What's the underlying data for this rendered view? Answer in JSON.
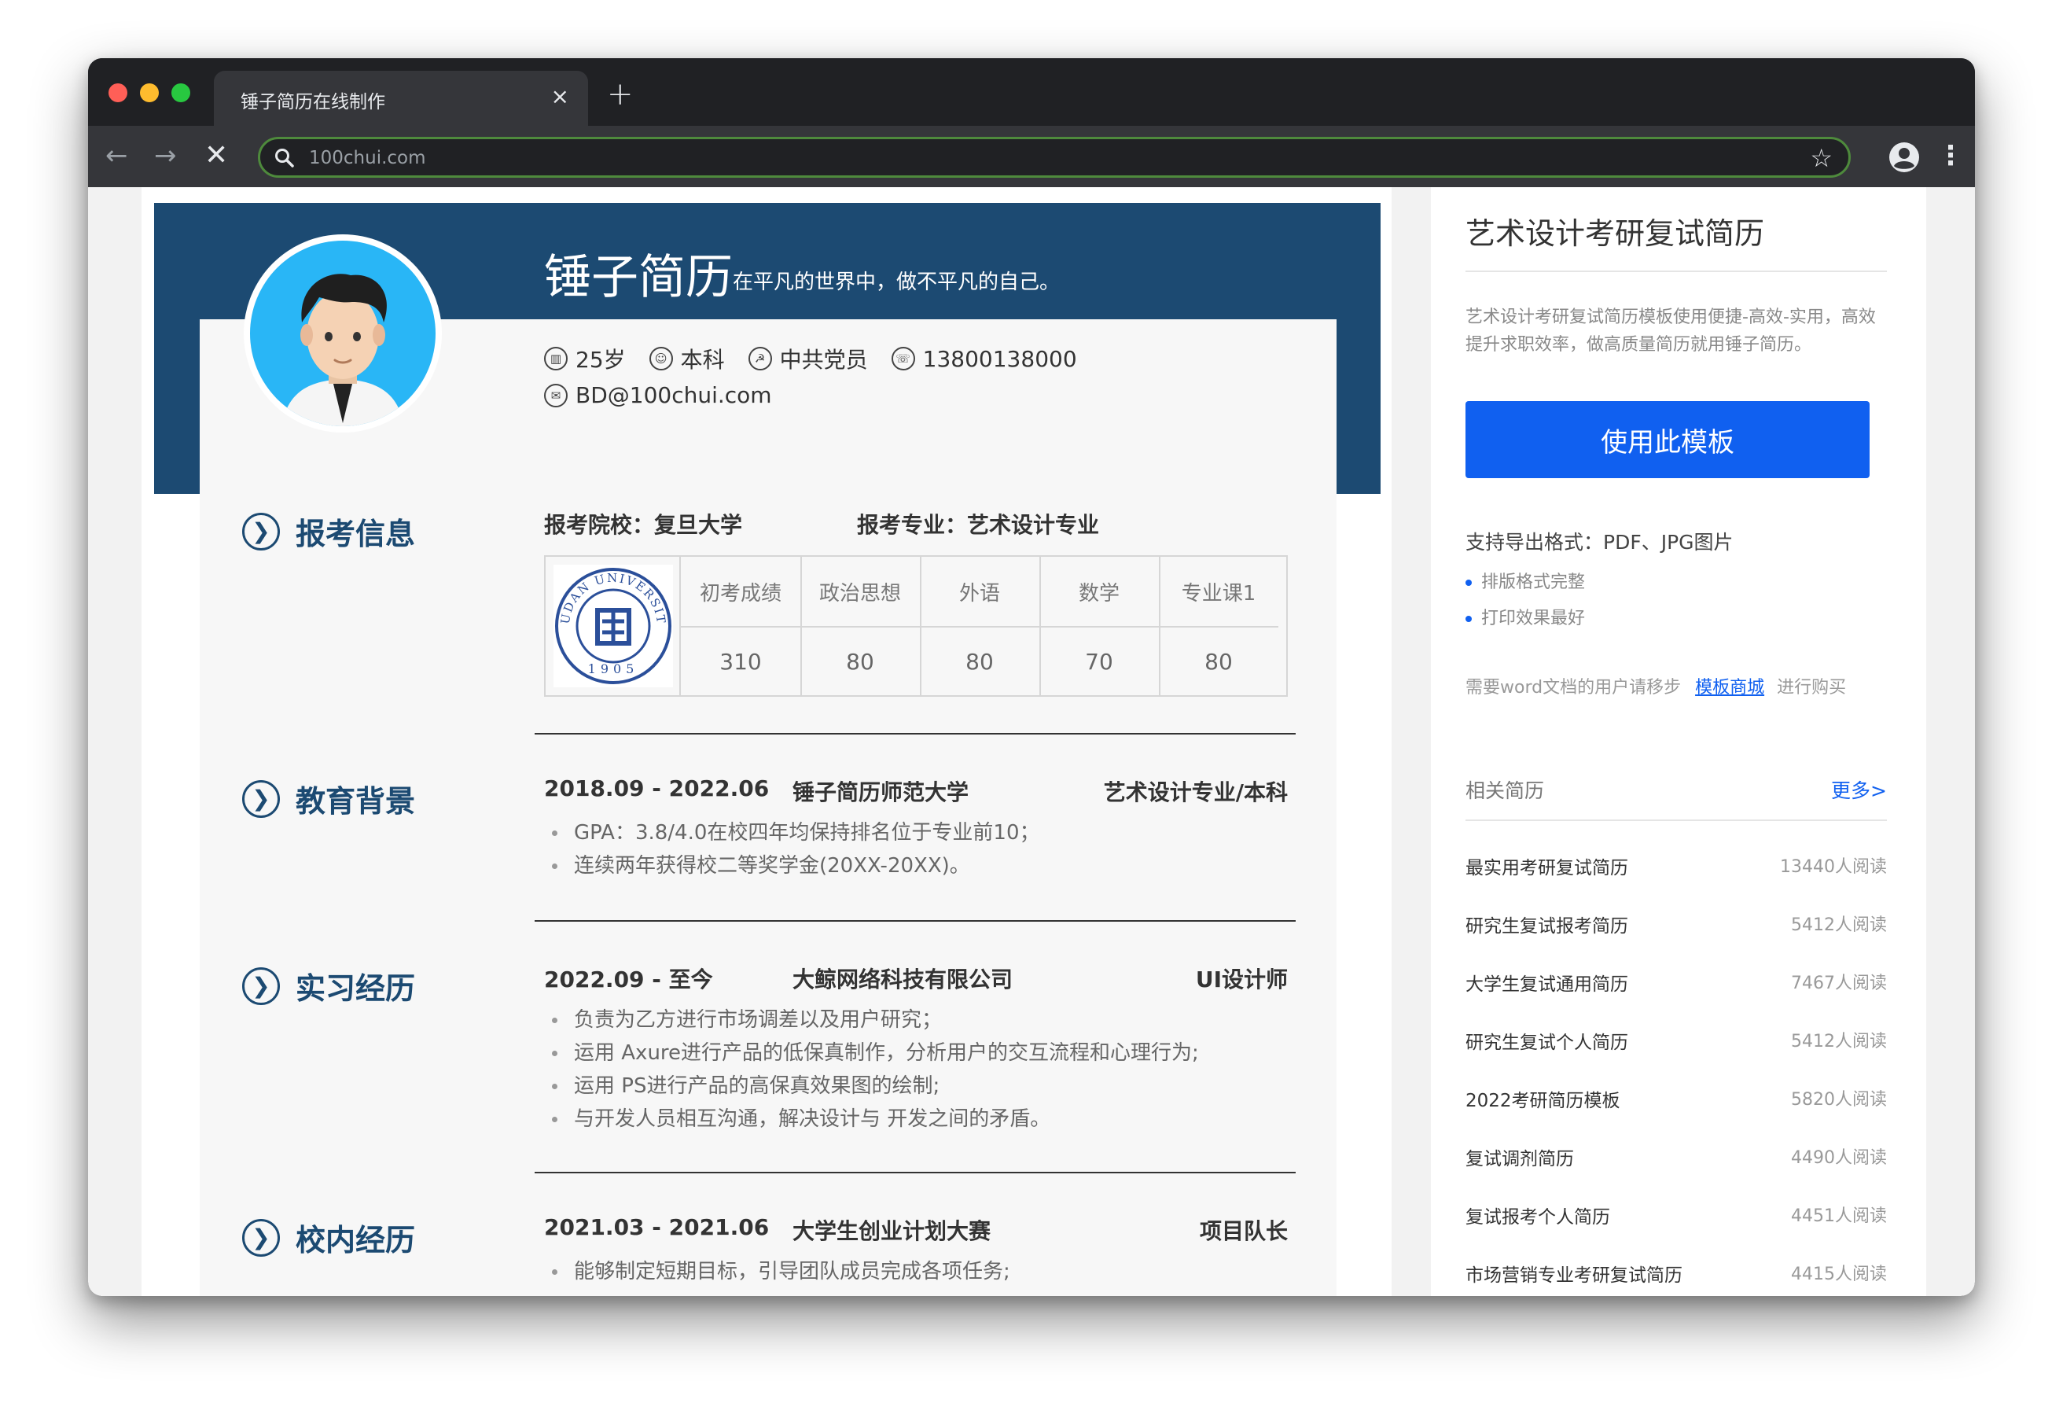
{
  "browser": {
    "tab_title": "锤子简历在线制作",
    "tab_close": "×",
    "new_tab": "+",
    "back": "←",
    "forward": "→",
    "stop": "✕",
    "address": "100chui.com",
    "star": "☆",
    "menu": "⋮"
  },
  "resume": {
    "name": "锤子简历",
    "motto": "在平凡的世界中，做不平凡的自己。",
    "info": {
      "age": "25岁",
      "degree": "本科",
      "politics": "中共党员",
      "phone": "13800138000",
      "email": "BD@100chui.com"
    },
    "sections": {
      "apply": {
        "title": "报考信息",
        "school": "报考院校：复旦大学",
        "major": "报考专业：艺术设计专业",
        "scores": [
          {
            "label": "初考成绩",
            "value": "310"
          },
          {
            "label": "政治思想",
            "value": "80"
          },
          {
            "label": "外语",
            "value": "80"
          },
          {
            "label": "数学",
            "value": "70"
          },
          {
            "label": "专业课1",
            "value": "80"
          }
        ],
        "logo_text": "FUDAN UNIVERSITY",
        "logo_year": "1905"
      },
      "education": {
        "title": "教育背景",
        "date": "2018.09 - 2022.06",
        "org": "锤子简历师范大学",
        "role": "艺术设计专业/本科",
        "bullets": [
          "GPA：3.8/4.0在校四年均保持排名位于专业前10；",
          "连续两年获得校二等奖学金(20XX-20XX)。"
        ]
      },
      "internship": {
        "title": "实习经历",
        "date": "2022.09 - 至今",
        "org": "大鲸网络科技有限公司",
        "role": "UI设计师",
        "bullets": [
          "负责为乙方进行市场调差以及用户研究；",
          "运用 Axure进行产品的低保真制作，分析用户的交互流程和心理行为;",
          "运用 PS进行产品的高保真效果图的绘制;",
          "与开发人员相互沟通，解决设计与 开发之间的矛盾。"
        ]
      },
      "campus": {
        "title": "校内经历",
        "date": "2021.03 - 2021.06",
        "org": "大学生创业计划大赛",
        "role": "项目队长",
        "bullets": [
          "能够制定短期目标，引导团队成员完成各项任务;"
        ]
      }
    }
  },
  "sidebar": {
    "title": "艺术设计考研复试简历",
    "description": "艺术设计考研复试简历模板使用便捷-高效-实用，高效提升求职效率，做高质量简历就用锤子简历。",
    "use_button": "使用此模板",
    "export_formats": "支持导出格式：PDF、JPG图片",
    "features": [
      "排版格式完整",
      "打印效果最好"
    ],
    "word_prefix": "需要word文档的用户请移步",
    "word_link": "模板商城",
    "word_suffix": "进行购买",
    "related_label": "相关简历",
    "more_label": "更多>",
    "related": [
      {
        "title": "最实用考研复试简历",
        "reads": "13440人阅读"
      },
      {
        "title": "研究生复试报考简历",
        "reads": "5412人阅读"
      },
      {
        "title": "大学生复试通用简历",
        "reads": "7467人阅读"
      },
      {
        "title": "研究生复试个人简历",
        "reads": "5412人阅读"
      },
      {
        "title": "2022考研简历模板",
        "reads": "5820人阅读"
      },
      {
        "title": "复试调剂简历",
        "reads": "4490人阅读"
      },
      {
        "title": "复试报考个人简历",
        "reads": "4451人阅读"
      },
      {
        "title": "市场营销专业考研复试简历",
        "reads": "4415人阅读"
      }
    ]
  },
  "colors": {
    "banner": "#1c4a72",
    "accent": "#1060f0",
    "browser_frame": "#202124",
    "toolbar": "#35363a"
  }
}
